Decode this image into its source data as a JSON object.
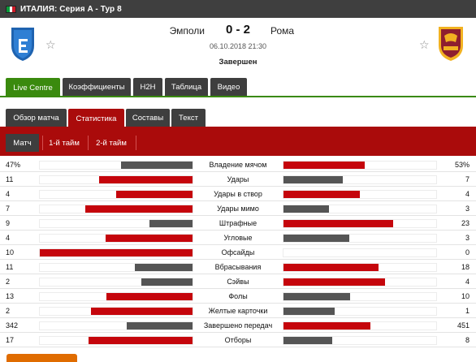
{
  "league": {
    "name": "ИТАЛИЯ: Серия A - Тур 8",
    "flag_colors": [
      "#0a9a3a",
      "#ffffff",
      "#ce1b28"
    ]
  },
  "match": {
    "home_team": "Эмполи",
    "away_team": "Рома",
    "score": "0 - 2",
    "datetime": "06.10.2018 21:30",
    "status": "Завершен"
  },
  "icons": {
    "favorite": "☆"
  },
  "main_tabs": [
    {
      "label": "Live Centre",
      "active": true
    },
    {
      "label": "Коэффициенты",
      "active": false
    },
    {
      "label": "H2H",
      "active": false
    },
    {
      "label": "Таблица",
      "active": false
    },
    {
      "label": "Видео",
      "active": false
    }
  ],
  "sub_tabs": [
    {
      "label": "Обзор матча",
      "active": false
    },
    {
      "label": "Статистика",
      "active": true
    },
    {
      "label": "Составы",
      "active": false
    },
    {
      "label": "Текст",
      "active": false
    }
  ],
  "period_tabs": [
    {
      "label": "Матч",
      "active": true
    },
    {
      "label": "1-й тайм",
      "active": false
    },
    {
      "label": "2-й тайм",
      "active": false
    }
  ],
  "colors": {
    "accent_green": "#3a8a0e",
    "accent_red": "#aa0b0b",
    "bar_leader": "#c5050c",
    "bar_other": "#555555",
    "tab_dark": "#3e3e3e"
  },
  "stats": [
    {
      "name": "Владение мячом",
      "home": "47%",
      "away": "53%",
      "home_value": 47,
      "away_value": 53
    },
    {
      "name": "Удары",
      "home": "11",
      "away": "7",
      "home_value": 11,
      "away_value": 7
    },
    {
      "name": "Удары в створ",
      "home": "4",
      "away": "4",
      "home_value": 4,
      "away_value": 4
    },
    {
      "name": "Удары мимо",
      "home": "7",
      "away": "3",
      "home_value": 7,
      "away_value": 3
    },
    {
      "name": "Штрафные",
      "home": "9",
      "away": "23",
      "home_value": 9,
      "away_value": 23
    },
    {
      "name": "Угловые",
      "home": "4",
      "away": "3",
      "home_value": 4,
      "away_value": 3
    },
    {
      "name": "Офсайды",
      "home": "10",
      "away": "0",
      "home_value": 10,
      "away_value": 0
    },
    {
      "name": "Вбрасывания",
      "home": "11",
      "away": "18",
      "home_value": 11,
      "away_value": 18
    },
    {
      "name": "Сэйвы",
      "home": "2",
      "away": "4",
      "home_value": 2,
      "away_value": 4
    },
    {
      "name": "Фолы",
      "home": "13",
      "away": "10",
      "home_value": 13,
      "away_value": 10
    },
    {
      "name": "Желтые карточки",
      "home": "2",
      "away": "1",
      "home_value": 2,
      "away_value": 1
    },
    {
      "name": "Завершено передач",
      "home": "342",
      "away": "451",
      "home_value": 342,
      "away_value": 451
    },
    {
      "name": "Отборы",
      "home": "17",
      "away": "8",
      "home_value": 17,
      "away_value": 8
    }
  ]
}
